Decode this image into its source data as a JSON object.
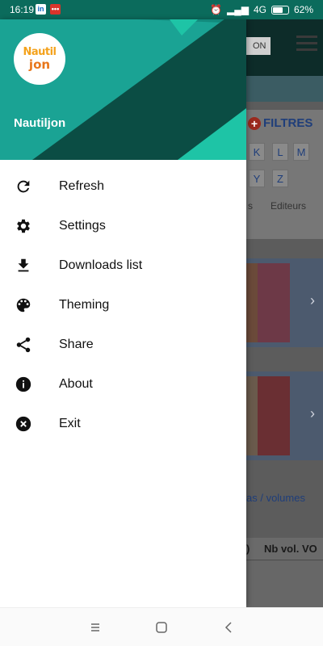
{
  "status_bar": {
    "time": "16:19",
    "network": "4G",
    "battery": "62%"
  },
  "drawer": {
    "app_name": "Nautiljon",
    "logo_text_top": "Nautil",
    "logo_text_bottom": "jon",
    "items": [
      {
        "label": "Refresh",
        "icon": "refresh-icon"
      },
      {
        "label": "Settings",
        "icon": "gear-icon"
      },
      {
        "label": "Downloads list",
        "icon": "download-icon"
      },
      {
        "label": "Theming",
        "icon": "palette-icon"
      },
      {
        "label": "Share",
        "icon": "share-icon"
      },
      {
        "label": "About",
        "icon": "info-icon"
      },
      {
        "label": "Exit",
        "icon": "close-circle-icon"
      }
    ]
  },
  "background": {
    "search_text": "ON",
    "filters_label": "FILTRES",
    "letters": [
      "K",
      "L",
      "M",
      "Y",
      "Z"
    ],
    "col_s": "s",
    "col_editeurs": "Editeurs",
    "link_text": "as / volumes",
    "table_header": "Nb vol. VO",
    "table_header_left": ")"
  },
  "colors": {
    "header_dark": "#0b4d44",
    "header_teal": "#1aa394",
    "header_light": "#1ec4a6"
  }
}
